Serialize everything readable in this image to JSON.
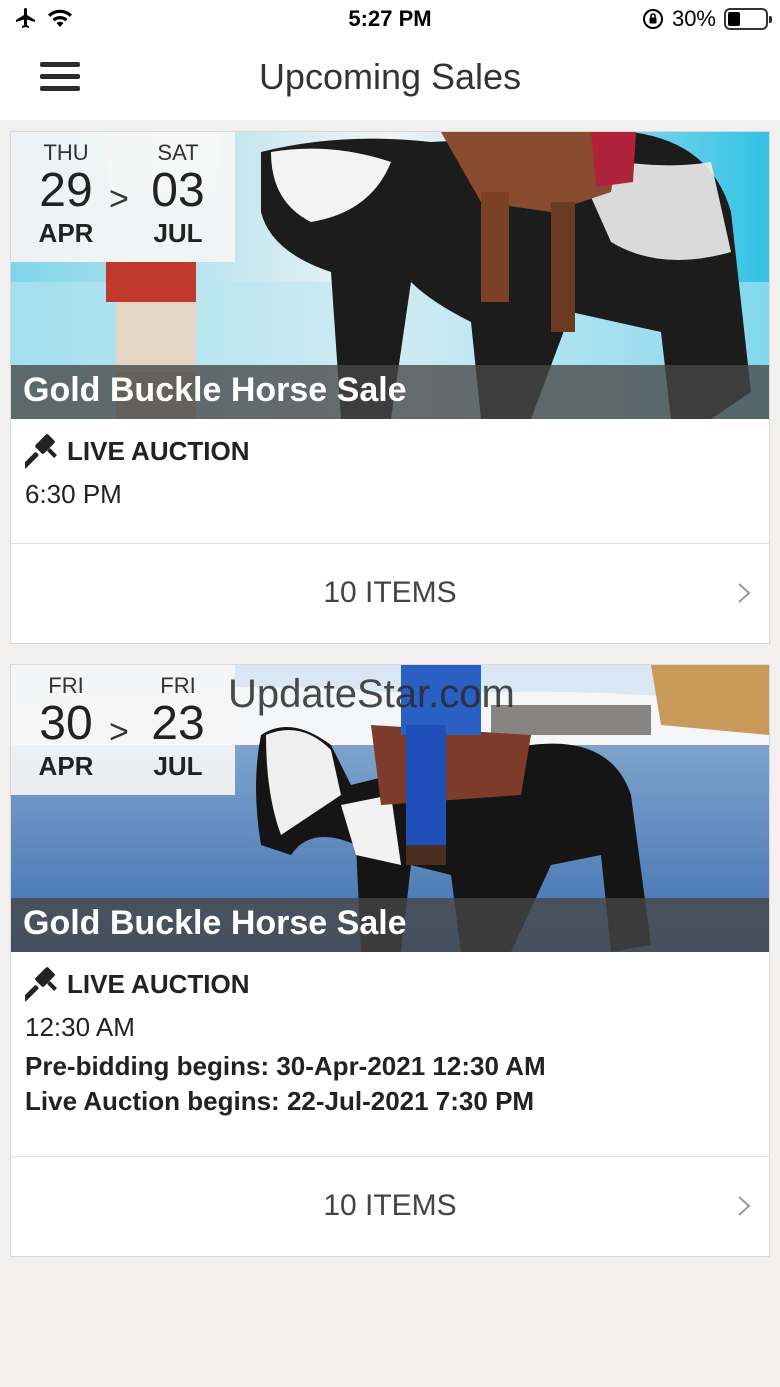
{
  "status_bar": {
    "time": "5:27 PM",
    "battery_percent": "30%",
    "battery_level": 0.3
  },
  "header": {
    "title": "Upcoming Sales"
  },
  "sales": [
    {
      "start": {
        "dow": "THU",
        "day": "29",
        "month": "APR"
      },
      "end": {
        "dow": "SAT",
        "day": "03",
        "month": "JUL"
      },
      "arrow": ">",
      "title": "Gold Buckle Horse Sale",
      "auction_type": "LIVE AUCTION",
      "time": "6:30 PM",
      "items_label": "10 ITEMS"
    },
    {
      "start": {
        "dow": "FRI",
        "day": "30",
        "month": "APR"
      },
      "end": {
        "dow": "FRI",
        "day": "23",
        "month": "JUL"
      },
      "arrow": ">",
      "title": "Gold Buckle Horse Sale",
      "auction_type": "LIVE AUCTION",
      "time": "12:30 AM",
      "pre_bidding": "Pre-bidding begins: 30-Apr-2021 12:30 AM",
      "live_begins": "Live Auction begins: 22-Jul-2021 7:30 PM",
      "items_label": "10 ITEMS"
    }
  ],
  "watermark": "UpdateStar.com"
}
